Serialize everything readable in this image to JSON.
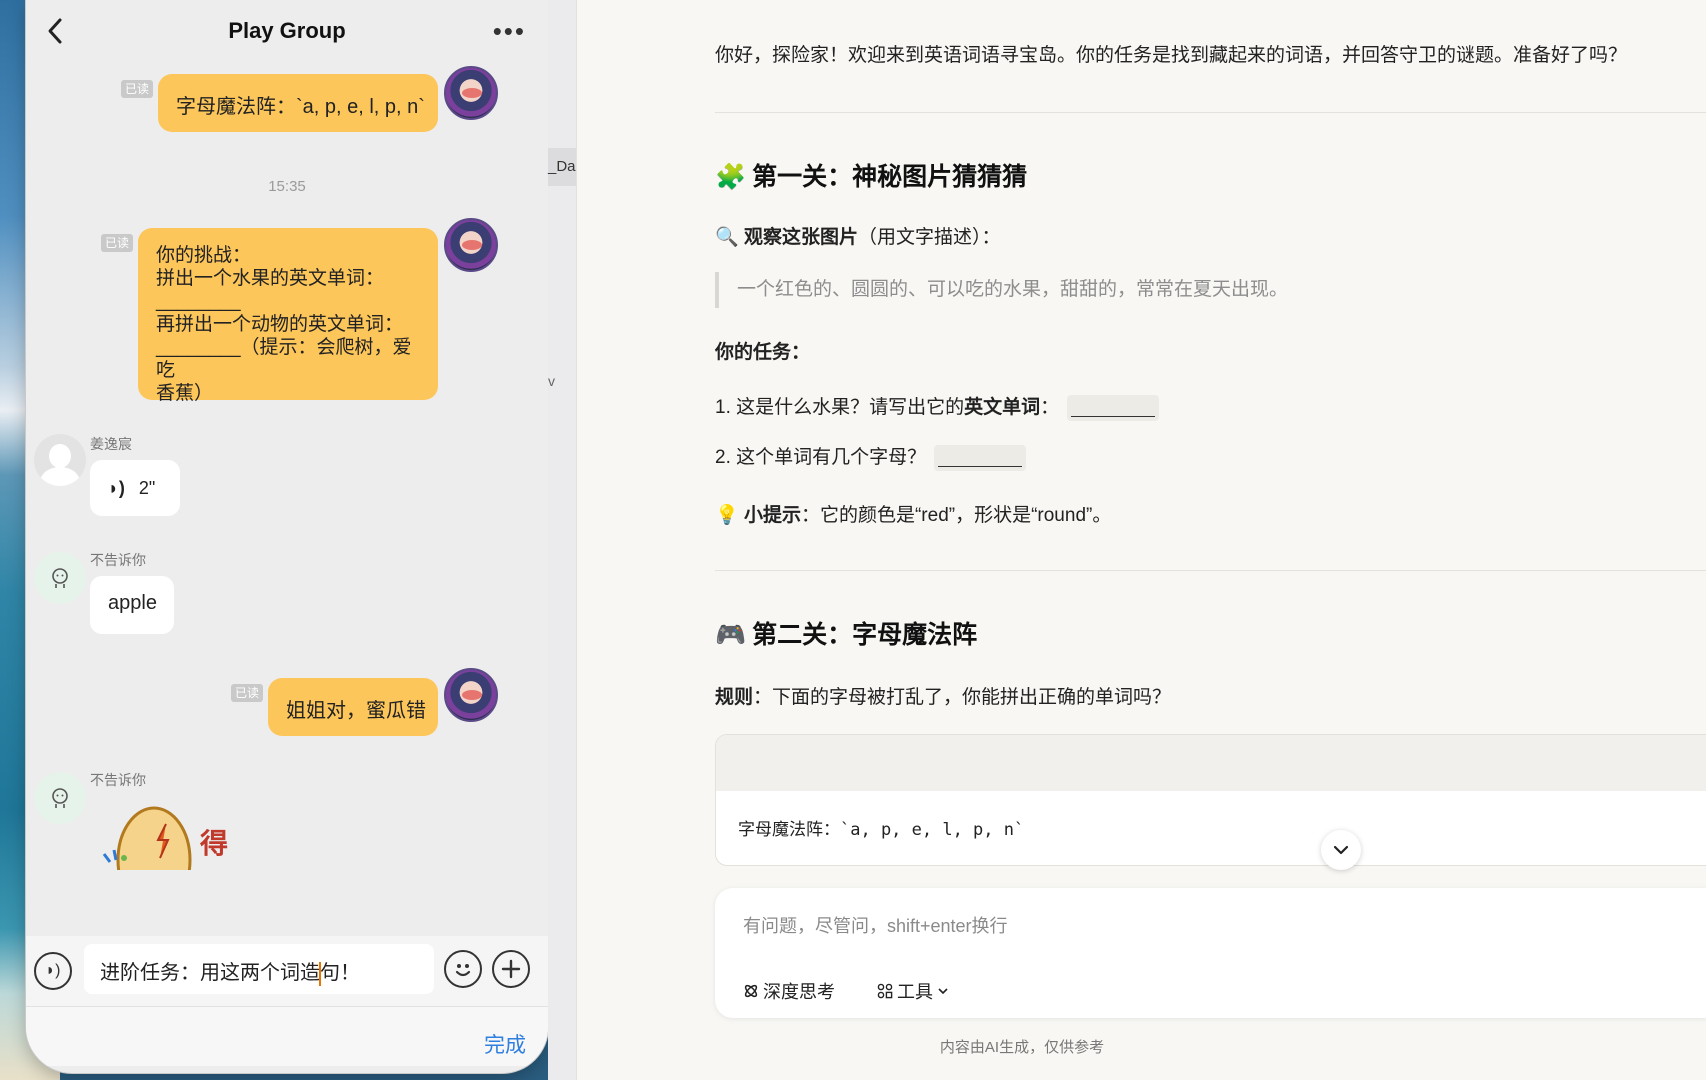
{
  "chat": {
    "title": "Play Group",
    "messages": {
      "m1_read": "已读",
      "m1_text": "字母魔法阵：`a, p, e, l, p, n`",
      "timestamp": "15:35",
      "m2_read": "已读",
      "m2_l1": "你的挑战：",
      "m2_l2": "拼出一个水果的英文单词：",
      "m2_l3": "________",
      "m2_l4": "再拼出一个动物的英文单词：",
      "m2_l5": "________（提示：会爬树，爱吃",
      "m2_l6": "香蕉）",
      "m3_sender": "姜逸宸",
      "m3_voice": "2\"",
      "m4_sender": "不告诉你",
      "m4_text": "apple",
      "m5_read": "已读",
      "m5_text": "姐姐对，蜜瓜错",
      "m6_sender": "不告诉你",
      "sticker_text": "得"
    },
    "input": {
      "before_caret": "进阶任务：用这两个词造",
      "after_caret": "句！"
    },
    "done_label": "完成"
  },
  "sliver": {
    "tab_text": "_Da",
    "side_text": "v"
  },
  "ai": {
    "greeting": "你好，探险家！欢迎来到英语词语寻宝岛。你的任务是找到藏起来的词语，并回答守卫的谜题。准备好了吗？",
    "level1": {
      "emoji": "🧩",
      "title": "第一关：神秘图片猜猜猜",
      "observe_emoji": "🔍",
      "observe_bold": "观察这张图片",
      "observe_rest": "（用文字描述）：",
      "quote": "一个红色的、圆圆的、可以吃的水果，甜甜的，常常在夏天出现。",
      "task_label": "你的任务：",
      "q1_prefix": "1. 这是什么水果？请写出它的",
      "q1_bold": "英文单词",
      "q1_suffix": "：",
      "q2": "2. 这个单词有几个字母？",
      "hint_emoji": "💡",
      "hint_bold": "小提示",
      "hint_rest": "：它的颜色是“red”，形状是“round”。"
    },
    "level2": {
      "emoji": "🎮",
      "title": "第二关：字母魔法阵",
      "rule_bold": "规则",
      "rule_rest": "：下面的字母被打乱了，你能拼出正确的单词吗？",
      "code": "字母魔法阵：`a, p, e, l, p, n`"
    },
    "input": {
      "placeholder": "有问题，尽管问，shift+enter换行",
      "deep_think": "深度思考",
      "tools": "工具"
    },
    "footer": "内容由AI生成，仅供参考"
  }
}
